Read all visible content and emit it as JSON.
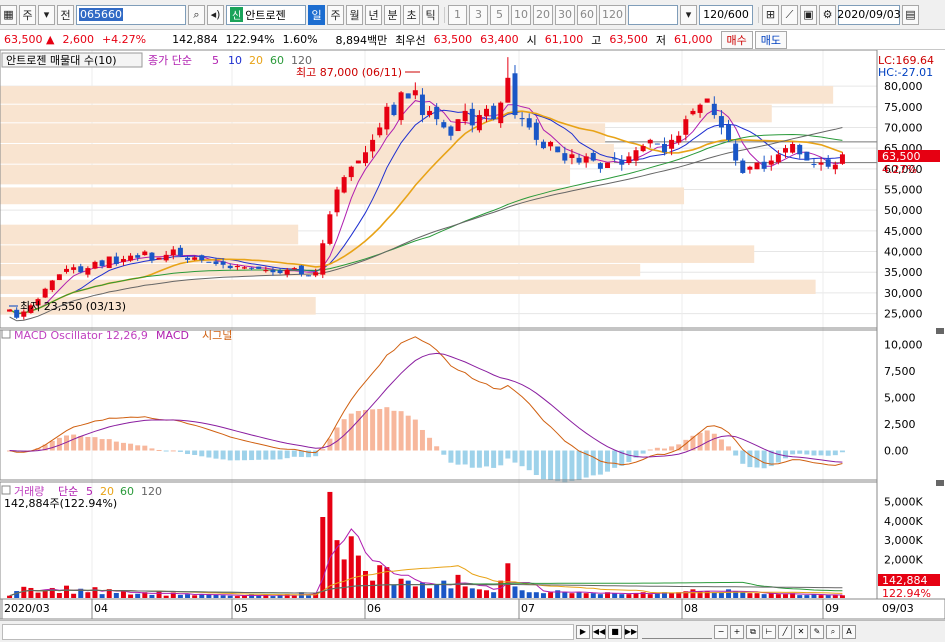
{
  "toolbar": {
    "mode": "주",
    "jeon": "전",
    "code": "065660",
    "name": "안트로젠",
    "shin": "신",
    "periods": [
      "일",
      "주",
      "월",
      "년",
      "분",
      "초",
      "틱"
    ],
    "nums": [
      "1",
      "3",
      "5",
      "10",
      "20",
      "30",
      "60",
      "120"
    ],
    "count": "120/600",
    "date": "2020/09/03"
  },
  "quote": {
    "price": "63,500",
    "arrow": "▲",
    "change": "2,600",
    "pct": "+4.27%",
    "volume": "142,884",
    "vol_ratio": "122.94%",
    "turnover": "1.60%",
    "amount": "8,894백만",
    "best_label": "최우선",
    "best_sell": "63,500",
    "best_buy": "63,400",
    "open_label": "시",
    "open": "61,100",
    "high_label": "고",
    "high": "63,500",
    "low_label": "저",
    "low": "61,000",
    "buy_btn": "매수",
    "sell_btn": "매도"
  },
  "price_panel": {
    "legend_title": "안트로젠 매물대 수(10)",
    "legend_ma": "종가 단순",
    "ma": [
      "5",
      "10",
      "20",
      "60",
      "120"
    ],
    "lc": "LC:169.64",
    "hc": "HC:-27.01",
    "max_label": "최고 87,000 (06/11)",
    "min_label": "최저 23,550 (03/13)",
    "yticks": [
      "80,000",
      "75,000",
      "70,000",
      "65,000",
      "60,000",
      "55,000",
      "50,000",
      "45,000",
      "40,000",
      "35,000",
      "30,000",
      "25,000"
    ],
    "cur_price": "63,500",
    "cur_pct": "4.27%"
  },
  "macd_panel": {
    "legend1": "MACD Oscillator 12,26,9",
    "legend2": "MACD",
    "legend3": "시그널",
    "yticks": [
      "10,000",
      "7,500",
      "5,000",
      "2,500",
      "0.00"
    ]
  },
  "vol_panel": {
    "legend1": "거래량",
    "legend2": "단순",
    "ma": [
      "5",
      "20",
      "60",
      "120"
    ],
    "sub": "142,884주(122.94%)",
    "yticks": [
      "5,000K",
      "4,000K",
      "3,000K",
      "2,000K",
      "1,000K"
    ],
    "cur": "142,884",
    "cur_pct": "122.94%"
  },
  "xaxis": {
    "labels": [
      "2020/03",
      "04",
      "05",
      "06",
      "07",
      "08",
      "09",
      "09/03"
    ]
  },
  "colors": {
    "up": "#e60012",
    "down": "#1a56c6",
    "ma5": "#b01eb0",
    "ma10": "#1e2fd0",
    "ma20": "#e8a317",
    "ma60": "#2a9a3a",
    "ma120": "#666666",
    "profile": "#f9e4d0",
    "osc_pos": "#f7b79c",
    "osc_neg": "#9ed2ea"
  },
  "chart_data": {
    "type": "candlestick",
    "price_range": [
      22000,
      88000
    ],
    "volume_profile": [
      {
        "low": 24500,
        "high": 29000,
        "len": 0.36
      },
      {
        "low": 29500,
        "high": 33200,
        "len": 0.93
      },
      {
        "low": 33800,
        "high": 37000,
        "len": 0.73
      },
      {
        "low": 37000,
        "high": 41500,
        "len": 0.86
      },
      {
        "low": 41500,
        "high": 46500,
        "len": 0.34
      },
      {
        "low": 51200,
        "high": 55500,
        "len": 0.78
      },
      {
        "low": 56000,
        "high": 61000,
        "len": 0.65
      },
      {
        "low": 61000,
        "high": 66000,
        "len": 0.7
      },
      {
        "low": 66000,
        "high": 71000,
        "len": 0.69
      },
      {
        "low": 71000,
        "high": 75500,
        "len": 0.88
      },
      {
        "low": 75500,
        "high": 80000,
        "len": 0.95
      }
    ],
    "closes": [
      26000,
      24000,
      25500,
      27000,
      28500,
      31000,
      33000,
      34500,
      35800,
      36200,
      35000,
      36000,
      37500,
      36500,
      38800,
      37000,
      38200,
      39000,
      38500,
      40000,
      37800,
      38500,
      39200,
      40500,
      39000,
      38000,
      38600,
      37900,
      37500,
      37000,
      36800,
      36000,
      36500,
      36200,
      36000,
      35800,
      35500,
      35000,
      34800,
      35600,
      36000,
      34500,
      34000,
      35000,
      42000,
      49000,
      55000,
      58000,
      60500,
      62000,
      64000,
      67000,
      70000,
      75000,
      73000,
      78500,
      77000,
      79000,
      73000,
      74000,
      72000,
      70000,
      68000,
      72000,
      74000,
      70500,
      73000,
      74500,
      72000,
      76000,
      82000,
      73000,
      72000,
      70000,
      67000,
      65000,
      66500,
      64000,
      62000,
      63500,
      61500,
      63000,
      62000,
      60000,
      61500,
      62500,
      61000,
      63000,
      64500,
      65500,
      67000,
      66000,
      64000,
      67000,
      68000,
      72000,
      74000,
      75500,
      77000,
      73000,
      70000,
      67000,
      62000,
      59000,
      60500,
      61500,
      60000,
      62000,
      63500,
      65000,
      66000,
      63500,
      62000,
      61000,
      61500,
      60500,
      61000,
      63500
    ],
    "volume_max": 5600,
    "volumes": [
      120,
      360,
      580,
      520,
      280,
      420,
      520,
      260,
      640,
      220,
      480,
      300,
      560,
      200,
      460,
      260,
      340,
      180,
      220,
      300,
      160,
      380,
      120,
      280,
      160,
      200,
      140,
      180,
      200,
      160,
      140,
      120,
      100,
      140,
      180,
      120,
      160,
      100,
      140,
      200,
      120,
      300,
      140,
      260,
      4200,
      5500,
      3000,
      2000,
      3200,
      2200,
      1400,
      900,
      1700,
      1600,
      700,
      1000,
      900,
      600,
      800,
      500,
      700,
      900,
      500,
      1200,
      600,
      500,
      450,
      400,
      300,
      900,
      1800,
      600,
      400,
      300,
      300,
      250,
      300,
      400,
      300,
      250,
      300,
      250,
      250,
      200,
      300,
      250,
      200,
      200,
      250,
      300,
      200,
      250,
      300,
      250,
      300,
      350,
      450,
      350,
      350,
      300,
      300,
      450,
      350,
      300,
      250,
      250,
      200,
      250,
      200,
      200,
      250,
      150,
      150,
      200,
      150,
      150,
      150,
      140
    ]
  }
}
